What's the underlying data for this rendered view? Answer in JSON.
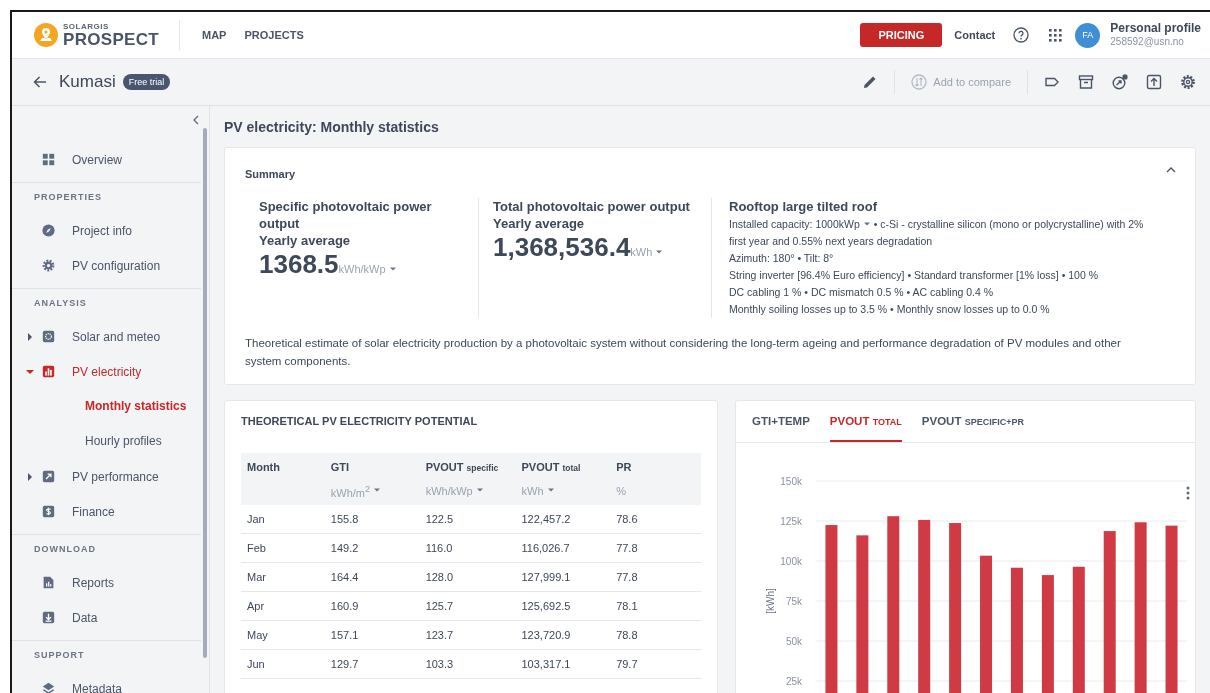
{
  "header": {
    "logo": {
      "brand_small": "SOLARGIS",
      "brand": "PROSPECT"
    },
    "nav": [
      {
        "label": "MAP",
        "selected": false
      },
      {
        "label": "PROJECTS",
        "selected": false
      }
    ],
    "pricing_button": "PRICING",
    "contact_link": "Contact",
    "profile": {
      "initials": "FA",
      "name": "Personal profile",
      "email": "258592@usn.no"
    }
  },
  "subheader": {
    "title": "Kumasi",
    "badge": "Free trial",
    "add_to_compare": {
      "label": "Add to compare",
      "disabled": true
    }
  },
  "sidebar": {
    "sections": [
      {
        "items": [
          {
            "label": "Overview",
            "selected": false
          }
        ]
      },
      {
        "heading": "PROPERTIES",
        "items": [
          {
            "label": "Project info",
            "selected": false
          },
          {
            "label": "PV configuration",
            "selected": false
          }
        ]
      },
      {
        "heading": "ANALYSIS",
        "items": [
          {
            "label": "Solar and meteo",
            "selected": false,
            "expanded": false
          },
          {
            "label": "PV electricity",
            "selected": true,
            "expanded": true,
            "children": [
              {
                "label": "Monthly statistics",
                "selected": true
              },
              {
                "label": "Hourly profiles",
                "selected": false
              }
            ]
          },
          {
            "label": "PV performance",
            "selected": false,
            "expanded": false
          },
          {
            "label": "Finance",
            "selected": false
          }
        ]
      },
      {
        "heading": "DOWNLOAD",
        "items": [
          {
            "label": "Reports",
            "selected": false
          },
          {
            "label": "Data",
            "selected": false
          }
        ]
      },
      {
        "heading": "SUPPORT",
        "items": [
          {
            "label": "Metadata",
            "selected": false
          }
        ]
      }
    ]
  },
  "page_title": "PV electricity: Monthly statistics",
  "summary": {
    "title": "Summary",
    "expanded": true,
    "metrics": [
      {
        "title": "Specific photovoltaic power output",
        "subtitle": "Yearly average",
        "value": "1368.5",
        "unit": "kWh/kWp"
      },
      {
        "title": "Total photovoltaic power output",
        "subtitle": "Yearly average",
        "value": "1,368,536.4",
        "unit": "kWh"
      }
    ],
    "configuration": {
      "title": "Rooftop large tilted roof",
      "capacity": "Installed capacity: 1000kWp",
      "lines": [
        "• c-Si - crystalline silicon (mono or polycrystalline) with 2%",
        "first year and 0.55% next years degradation",
        "Azimuth: 180° • Tilt: 8°",
        "String inverter [96.4% Euro efficiency] • Standard transformer [1% loss] • 100 %",
        "DC cabling 1 % • DC mismatch 0.5 % • AC cabling 0.4 %",
        "Monthly soiling losses up to 3.5 % • Monthly snow losses up to 0.0 %"
      ]
    },
    "note": "Theoretical estimate of solar electricity production by a photovoltaic system without considering the long-term ageing and performance degradation of PV modules and other system components."
  },
  "table": {
    "title": "THEORETICAL PV ELECTRICITY POTENTIAL",
    "columns": [
      {
        "label": "Month"
      },
      {
        "label": "GTI",
        "unit": "kWh/m$^{2}$",
        "dropdown": true
      },
      {
        "label": "PVOUT",
        "qualifier": "specific",
        "unit": "kWh/kWp",
        "dropdown": true
      },
      {
        "label": "PVOUT",
        "qualifier": "total",
        "unit": "kWh",
        "dropdown": true
      },
      {
        "label": "PR",
        "unit": "%",
        "dropdown": false
      }
    ],
    "rows": [
      [
        "Jan",
        "155.8",
        "122.5",
        "122,457.2",
        "78.6"
      ],
      [
        "Feb",
        "149.2",
        "116.0",
        "116,026.7",
        "77.8"
      ],
      [
        "Mar",
        "164.4",
        "128.0",
        "127,999.1",
        "77.8"
      ],
      [
        "Apr",
        "160.9",
        "125.7",
        "125,692.5",
        "78.1"
      ],
      [
        "May",
        "157.1",
        "123.7",
        "123,720.9",
        "78.8"
      ],
      [
        "Jun",
        "129.7",
        "103.3",
        "103,317.1",
        "79.7"
      ]
    ]
  },
  "chart_panel": {
    "tabs": [
      {
        "label": "GTI+TEMP",
        "selected": false
      },
      {
        "label": "PVOUT",
        "qualifier": "TOTAL",
        "selected": true
      },
      {
        "label": "PVOUT",
        "qualifier": "SPECIFIC+PR",
        "selected": false
      }
    ],
    "chart_data": {
      "type": "bar",
      "ylabel": "[kWh]",
      "ylim": [
        0,
        150000
      ],
      "grid": true,
      "yticks": [
        {
          "value": 25000,
          "label": "25k"
        },
        {
          "value": 50000,
          "label": "50k"
        },
        {
          "value": 75000,
          "label": "75k"
        },
        {
          "value": 100000,
          "label": "100k"
        },
        {
          "value": 125000,
          "label": "125k"
        },
        {
          "value": 150000,
          "label": "150k"
        }
      ],
      "series": [
        {
          "color": "#d03a45",
          "values": [
            122460,
            116030,
            128000,
            125690,
            123720,
            103320,
            95800,
            91200,
            96400,
            118700,
            124200,
            122100
          ]
        }
      ]
    }
  }
}
